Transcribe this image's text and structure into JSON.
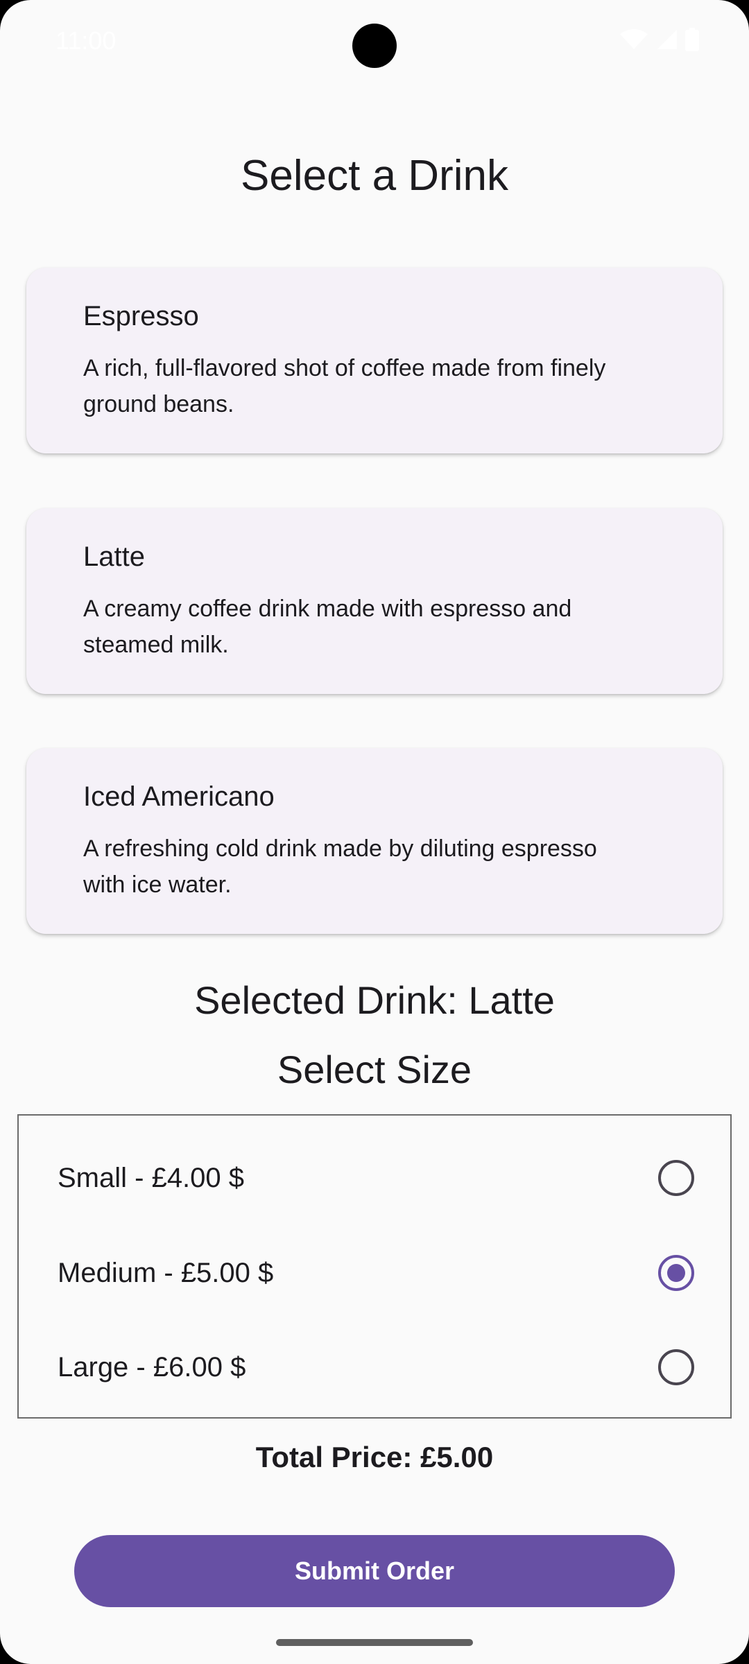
{
  "status_bar": {
    "time": "11:00",
    "icons": [
      "wifi-icon",
      "cellular-signal-icon",
      "battery-icon"
    ]
  },
  "page": {
    "title": "Select a Drink"
  },
  "drinks": [
    {
      "name": "Espresso",
      "description": "A rich, full-flavored shot of coffee made from finely ground beans."
    },
    {
      "name": "Latte",
      "description": "A creamy coffee drink made with espresso and steamed milk."
    },
    {
      "name": "Iced Americano",
      "description": "A refreshing cold drink made by diluting espresso with ice water."
    }
  ],
  "selection": {
    "selected_drink_text": "Selected Drink: Latte",
    "size_title": "Select Size"
  },
  "sizes": [
    {
      "label": "Small - £4.00 $",
      "checked": false
    },
    {
      "label": "Medium - £5.00 $",
      "checked": true
    },
    {
      "label": "Large - £6.00 $",
      "checked": false
    }
  ],
  "total_price_text": "Total Price: £5.00",
  "submit_label": "Submit Order",
  "colors": {
    "accent": "#6750a4",
    "card_background": "#f5f1f8",
    "screen_background": "#fafafa"
  }
}
